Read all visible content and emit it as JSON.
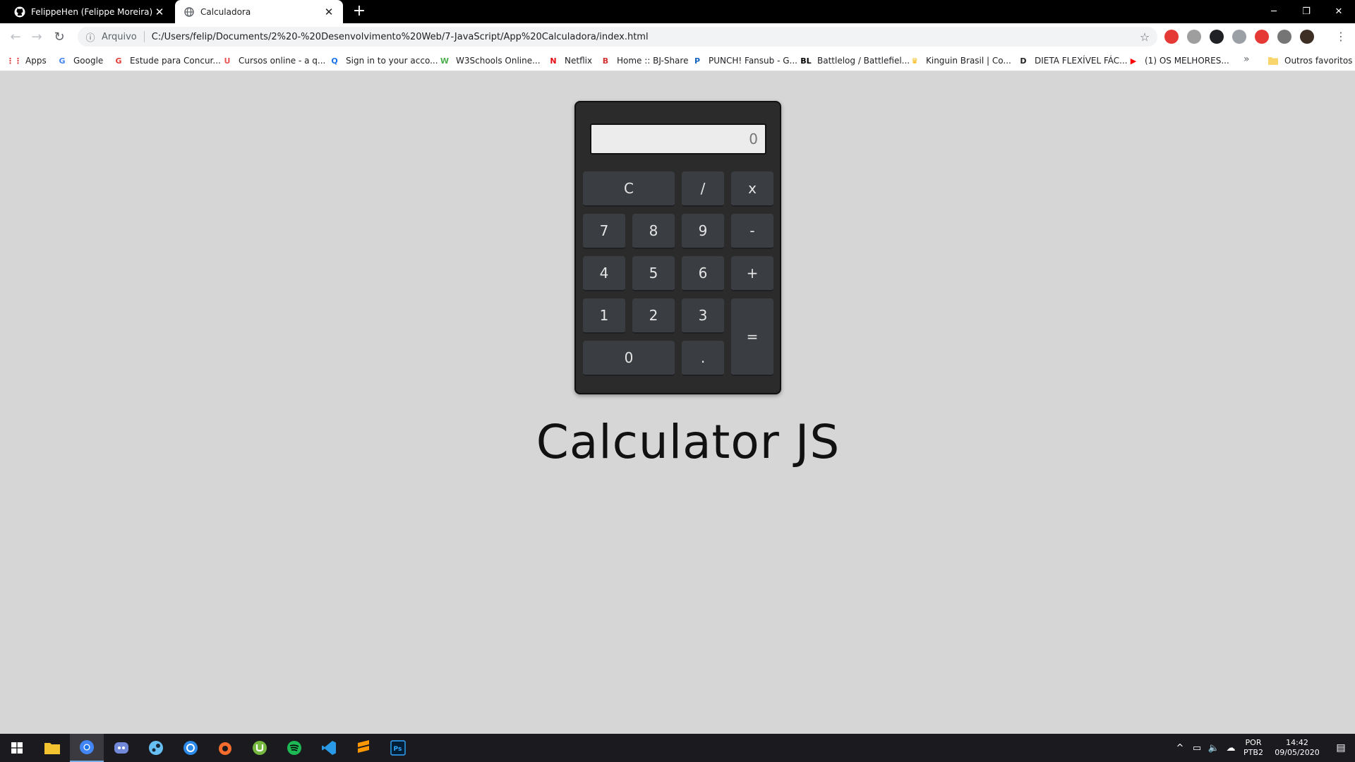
{
  "tabs": [
    {
      "title": "FelippeHen (Felippe Moreira)",
      "icon": "github-icon",
      "active": false
    },
    {
      "title": "Calculadora",
      "icon": "globe-icon",
      "active": true
    }
  ],
  "new_tab_label": "+",
  "window_controls": {
    "minimize": "─",
    "maximize": "❐",
    "close": "✕"
  },
  "toolbar": {
    "back": "←",
    "forward": "→",
    "reload": "↻",
    "info_glyph": "ⓘ",
    "scheme_label": "Arquivo",
    "url": "C:/Users/felip/Documents/2%20-%20Desenvolvimento%20Web/7-JavaScript/App%20Calculadora/index.html",
    "star": "☆",
    "menu": "⋮"
  },
  "extensions": [
    {
      "name": "ext-red-icon",
      "color": "#e53935"
    },
    {
      "name": "ext-grey-circle-icon",
      "color": "#9e9e9e"
    },
    {
      "name": "ext-es-icon",
      "color": "#202124"
    },
    {
      "name": "ext-cloud-icon",
      "color": "#9aa0a6"
    },
    {
      "name": "ext-opera-icon",
      "color": "#e53935"
    },
    {
      "name": "ext-gear-icon",
      "color": "#757575"
    },
    {
      "name": "profile-avatar-icon",
      "color": "#3e2f25"
    }
  ],
  "bookmarks": [
    {
      "label": "Apps",
      "glyph": "⋮⋮",
      "color": "#e53935"
    },
    {
      "label": "Google",
      "glyph": "G",
      "color": "#4285f4"
    },
    {
      "label": "Estude para Concur...",
      "glyph": "G",
      "color": "#e53935"
    },
    {
      "label": "Cursos online - a q...",
      "glyph": "U",
      "color": "#ec5252"
    },
    {
      "label": "Sign in to your acco...",
      "glyph": "Q",
      "color": "#1a73e8"
    },
    {
      "label": "W3Schools Online...",
      "glyph": "W",
      "color": "#4caf50"
    },
    {
      "label": "Netflix",
      "glyph": "N",
      "color": "#e50914"
    },
    {
      "label": "Home :: BJ-Share",
      "glyph": "B",
      "color": "#d32f2f"
    },
    {
      "label": "PUNCH! Fansub - G...",
      "glyph": "P",
      "color": "#1565c0"
    },
    {
      "label": "Battlelog / Battlefiel...",
      "glyph": "BL",
      "color": "#000000"
    },
    {
      "label": "Kinguin Brasil | Co...",
      "glyph": "♛",
      "color": "#f4b400"
    },
    {
      "label": "DIETA FLEXÍVEL FÁC...",
      "glyph": "D",
      "color": "#202124"
    },
    {
      "label": "(1) OS MELHORES...",
      "glyph": "▶",
      "color": "#ff0000"
    }
  ],
  "bookmarks_more": "»",
  "other_bookmarks": "Outros favoritos",
  "calculator": {
    "display_value": "0",
    "keys": {
      "clear": "C",
      "divide": "/",
      "multiply": "x",
      "seven": "7",
      "eight": "8",
      "nine": "9",
      "minus": "-",
      "four": "4",
      "five": "5",
      "six": "6",
      "plus": "+",
      "one": "1",
      "two": "2",
      "three": "3",
      "equals": "=",
      "zero": "0",
      "decimal": "."
    }
  },
  "page_title": "Calculator JS",
  "taskbar": {
    "apps": [
      {
        "name": "file-explorer-icon",
        "color": "#f4c430"
      },
      {
        "name": "chrome-icon",
        "color": "#4285f4",
        "active": true
      },
      {
        "name": "discord-icon",
        "color": "#7289da"
      },
      {
        "name": "steam-icon",
        "color": "#66c0f4"
      },
      {
        "name": "uplay-icon",
        "color": "#2c8be8"
      },
      {
        "name": "origin-icon",
        "color": "#f56c2d"
      },
      {
        "name": "utorrent-icon",
        "color": "#76b83f"
      },
      {
        "name": "spotify-icon",
        "color": "#1db954"
      },
      {
        "name": "vscode-icon",
        "color": "#2a9ae6"
      },
      {
        "name": "sublime-icon",
        "color": "#ff9800"
      },
      {
        "name": "photoshop-icon",
        "color": "#31a8ff"
      }
    ],
    "tray_chevron": "^",
    "language_line1": "POR",
    "language_line2": "PTB2",
    "time": "14:42",
    "date": "09/05/2020"
  }
}
